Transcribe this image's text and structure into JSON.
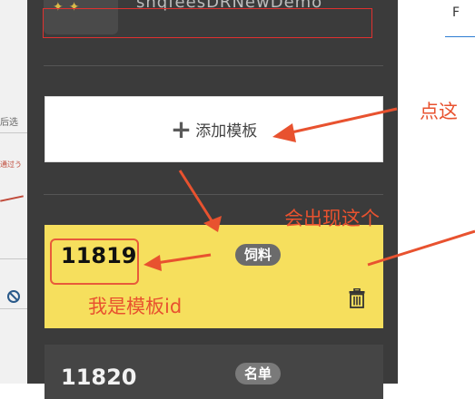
{
  "top_item": {
    "icon_text": "✦✦",
    "name": "shqfeesDRNewDemo"
  },
  "add_template": {
    "plus_icon": "+",
    "label": "添加模板"
  },
  "templates": [
    {
      "id": "11819",
      "tag": "饲料",
      "highlighted": true
    },
    {
      "id": "11820",
      "tag": "名单",
      "highlighted": false
    }
  ],
  "background": {
    "left_fragments": [
      "后选",
      "通过う"
    ],
    "right_glyph": "F"
  },
  "annotations": {
    "click_here": "点这",
    "appears": "会出现这个",
    "template_id": "我是模板id"
  },
  "colors": {
    "panel": "#3b3b3b",
    "card_yellow": "#f6df5d",
    "annotation_red": "#e8522f",
    "tag_gray": "#6b6b6b"
  }
}
